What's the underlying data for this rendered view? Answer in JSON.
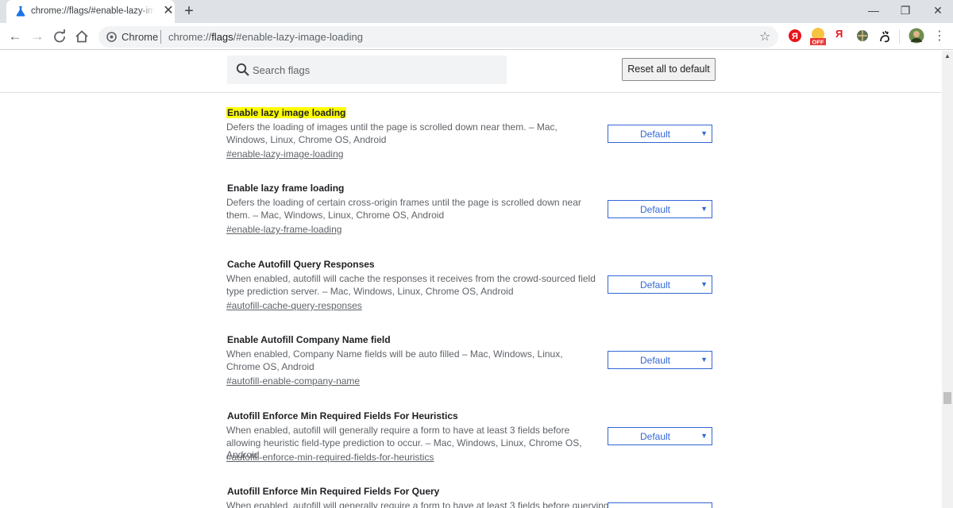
{
  "tab": {
    "title": "chrome://flags/#enable-lazy-image-loading",
    "close": "✕",
    "new_tab": "+"
  },
  "window": {
    "minimize": "—",
    "restore": "❐",
    "close": "✕"
  },
  "omnibox": {
    "label": "Chrome",
    "url_prefix": "chrome://",
    "url_host": "flags",
    "url_rest": "/#enable-lazy-image-loading"
  },
  "extensions": {
    "off_badge": "OFF",
    "yandex_letter": "Я"
  },
  "search": {
    "placeholder": "Search flags"
  },
  "reset_label": "Reset all to default",
  "experiments": [
    {
      "title": "Enable lazy image loading",
      "desc": "Defers the loading of images until the page is scrolled down near them. – Mac, Windows, Linux, Chrome OS, Android",
      "link": "#enable-lazy-image-loading",
      "value": "Default",
      "highlight": true
    },
    {
      "title": "Enable lazy frame loading",
      "desc": "Defers the loading of certain cross-origin frames until the page is scrolled down near them. – Mac, Windows, Linux, Chrome OS, Android",
      "link": "#enable-lazy-frame-loading",
      "value": "Default"
    },
    {
      "title": "Cache Autofill Query Responses",
      "desc": "When enabled, autofill will cache the responses it receives from the crowd-sourced field type prediction server. – Mac, Windows, Linux, Chrome OS, Android",
      "link": "#autofill-cache-query-responses",
      "value": "Default"
    },
    {
      "title": "Enable Autofill Company Name field",
      "desc": "When enabled, Company Name fields will be auto filled – Mac, Windows, Linux, Chrome OS, Android",
      "link": "#autofill-enable-company-name",
      "value": "Default"
    },
    {
      "title": "Autofill Enforce Min Required Fields For Heuristics",
      "desc": "When enabled, autofill will generally require a form to have at least 3 fields before allowing heuristic field-type prediction to occur. – Mac, Windows, Linux, Chrome OS, Android",
      "link": "#autofill-enforce-min-required-fields-for-heuristics",
      "value": "Default"
    },
    {
      "title": "Autofill Enforce Min Required Fields For Query",
      "desc": "When enabled, autofill will generally require a form to have at least 3 fields before querying",
      "link": "",
      "value": ""
    }
  ]
}
